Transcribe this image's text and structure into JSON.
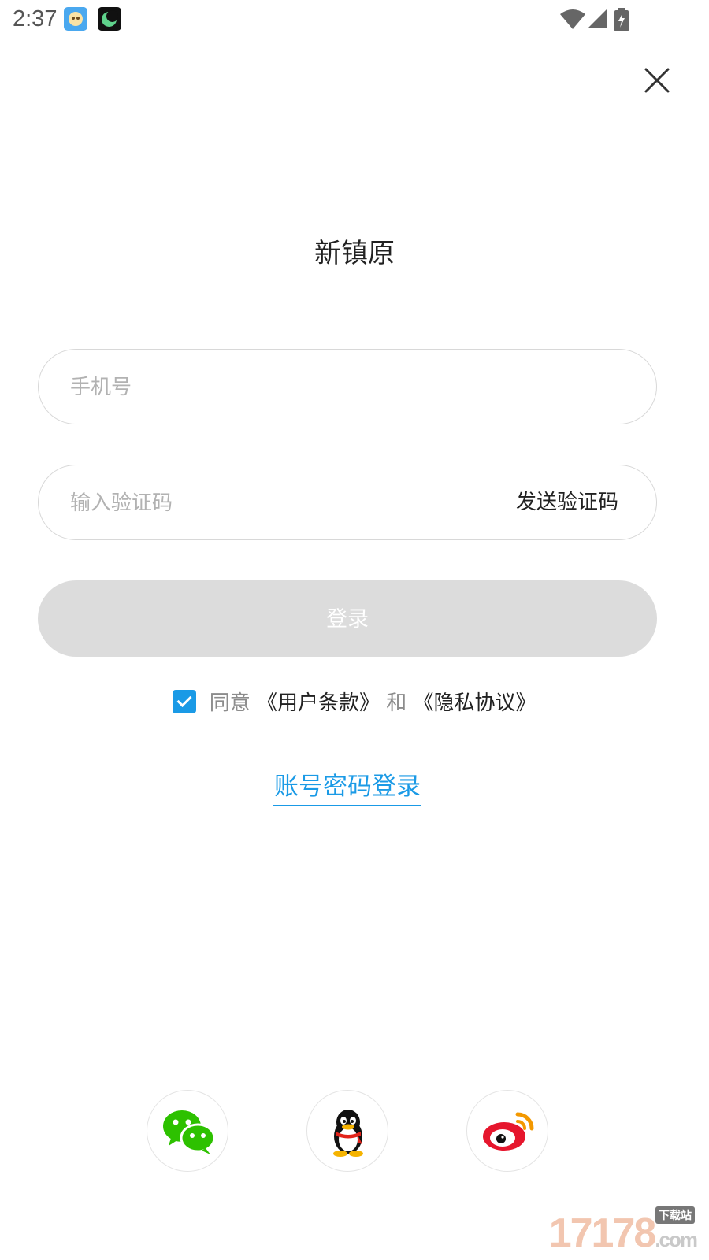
{
  "status_bar": {
    "time": "2:37",
    "notification_icons": [
      "baby-face-app-icon",
      "moon-sleep-app-icon"
    ],
    "system_icons": [
      "wifi-icon",
      "cellular-signal-icon",
      "battery-charging-icon"
    ]
  },
  "header": {
    "close_icon": "close-icon"
  },
  "app_title": "新镇原",
  "form": {
    "phone_placeholder": "手机号",
    "phone_value": "",
    "code_placeholder": "输入验证码",
    "code_value": "",
    "send_code_label": "发送验证码",
    "login_label": "登录"
  },
  "agreement": {
    "checked": true,
    "agree_text": "同意",
    "terms_link": "《用户条款》",
    "and_text": "和",
    "privacy_link": "《隐私协议》"
  },
  "alt_login_label": "账号密码登录",
  "social_logins": [
    "wechat-icon",
    "qq-icon",
    "weibo-icon"
  ],
  "watermark": {
    "number": "17178",
    "suffix": ".com",
    "tag": "下载站"
  },
  "colors": {
    "accent": "#1a9ae6",
    "button_disabled": "#dcdcdc",
    "placeholder": "#b2b2b2"
  }
}
